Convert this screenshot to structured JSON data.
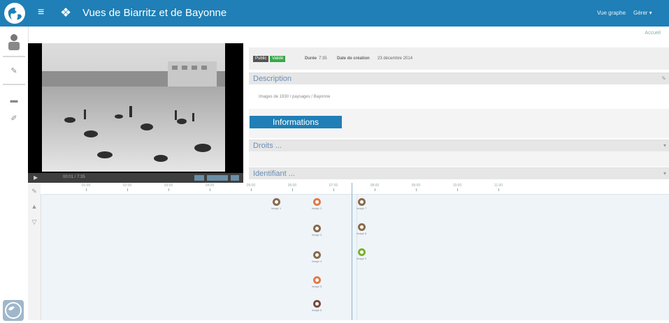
{
  "header": {
    "title": "Vues de Biarritz et de Bayonne",
    "link_graph": "Vue graphe",
    "link_user": "Gérer ▾",
    "sub_link": "Accueil"
  },
  "player": {
    "time": "00:01 / 7:35"
  },
  "meta": {
    "badge_public": "Public",
    "badge_status": "Validé",
    "duration_label": "Durée",
    "duration_value": "7:35",
    "created_label": "Date de création",
    "created_value": "23 décembre 2014"
  },
  "sections": {
    "description": "Description",
    "description_text": "Images de 1930 / paysages / Bayonne",
    "informations_button": "Informations",
    "droits": "Droits ...",
    "identifiant": "Identifiant ..."
  },
  "timeline": {
    "ticks": [
      "01:00",
      "02:00",
      "03:00",
      "04:00",
      "05:00",
      "06:00",
      "07:00",
      "08:00",
      "09:00",
      "10:00",
      "11:00"
    ],
    "nodes": [
      {
        "label": "Image 1",
        "color": "#8a6a4a"
      },
      {
        "label": "Image 2",
        "color": "#e07a4a"
      },
      {
        "label": "Image 3",
        "color": "#8a6a4a"
      },
      {
        "label": "Image 4",
        "color": "#8a6a4a"
      },
      {
        "label": "Image 5",
        "color": "#e07a4a"
      },
      {
        "label": "Image 6",
        "color": "#7a4a3a"
      },
      {
        "label": "Image 7",
        "color": "#8a6a4a"
      },
      {
        "label": "Image 8",
        "color": "#8a6a4a"
      },
      {
        "label": "Image 9",
        "color": "#7ab030"
      }
    ]
  },
  "colors": {
    "brand": "#1f7fb6",
    "status_green": "#3aa84a"
  }
}
